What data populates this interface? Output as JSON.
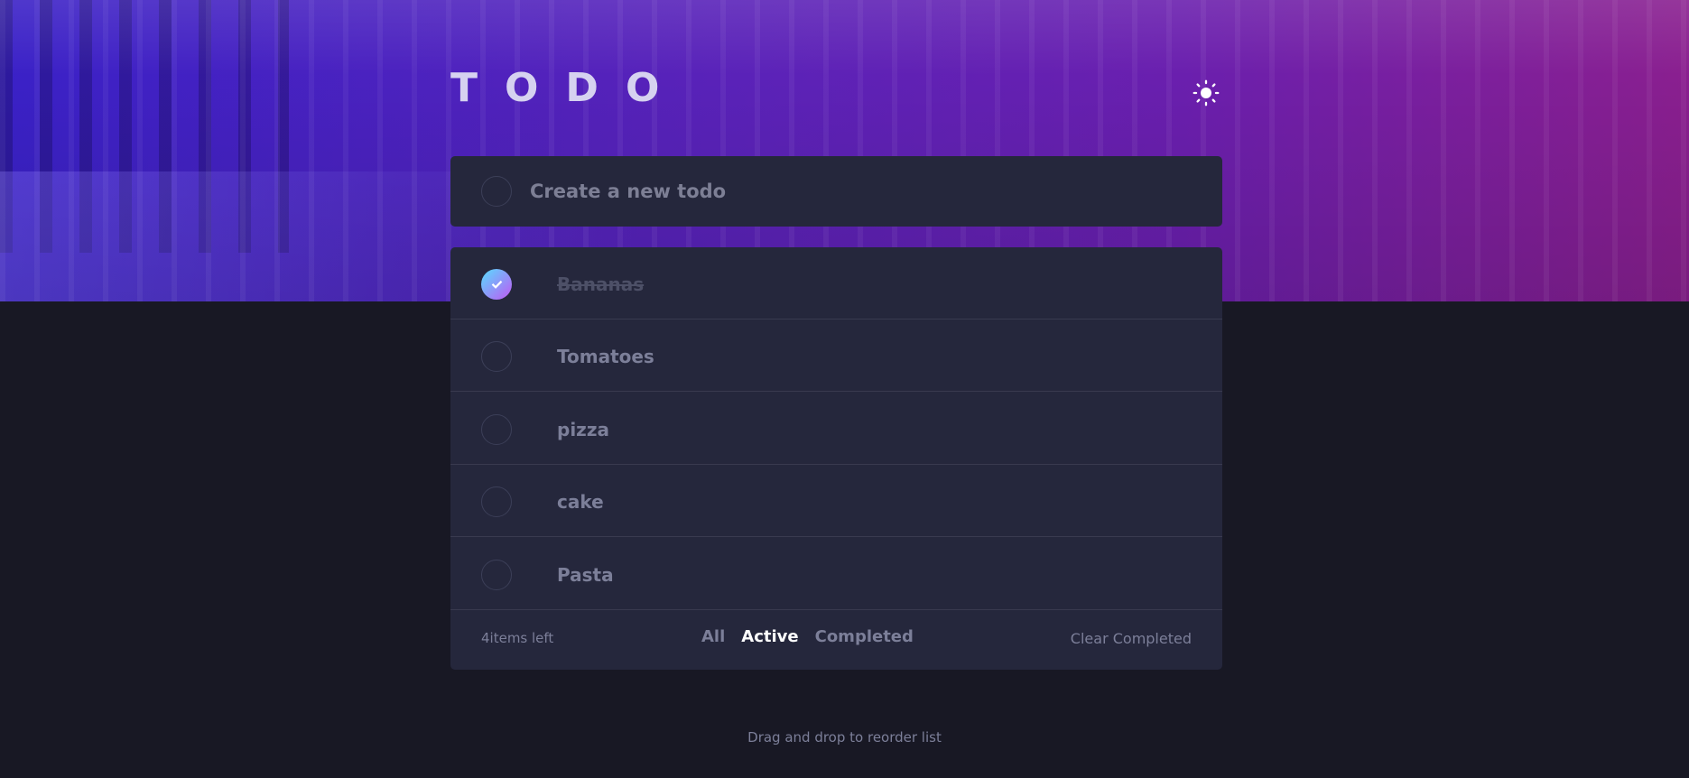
{
  "app": {
    "title": "TODO",
    "theme_icon": "sun-icon"
  },
  "new_todo": {
    "placeholder": "Create a new todo",
    "value": ""
  },
  "todos": [
    {
      "text": "Bananas",
      "completed": true
    },
    {
      "text": "Tomatoes",
      "completed": false
    },
    {
      "text": "pizza",
      "completed": false
    },
    {
      "text": "cake",
      "completed": false
    },
    {
      "text": "Pasta",
      "completed": false
    }
  ],
  "footer": {
    "items_left": "4items left",
    "filters": [
      {
        "label": "All",
        "selected": false
      },
      {
        "label": "Active",
        "selected": true
      },
      {
        "label": "Completed",
        "selected": false
      }
    ],
    "clear_label": "Clear Completed"
  },
  "hint": "Drag and drop to reorder list",
  "colors": {
    "background": "#181824",
    "card": "#25273c",
    "check_gradient_start": "#57ddff",
    "check_gradient_end": "#c058f3",
    "active_filter": "#ffffff"
  }
}
